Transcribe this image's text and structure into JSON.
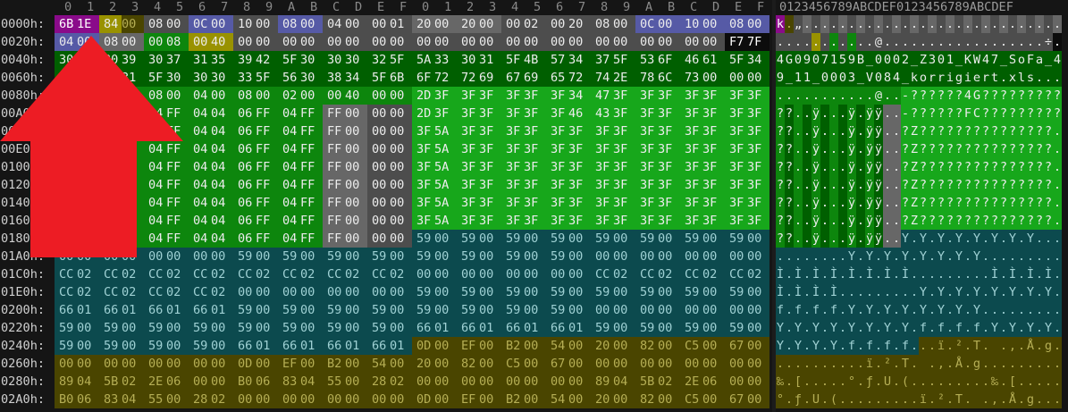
{
  "colors": {
    "green": "#0d860d",
    "lightgreen": "#17a71b",
    "darkgreen": "#005f00",
    "teal": "#0c4a4e",
    "olive": "#4a4500",
    "gray": "#4d4d4d",
    "lgray": "#676767",
    "purple": "#8a0b8a",
    "blue": "#565aa6",
    "yellow": "#999200",
    "white": "#ffffff",
    "black": "#0c0c0c",
    "arrow": "#ed1c24"
  },
  "header": {
    "hex_columns": "0 1 2 3 4 5 6 7 8 9 A B C D E F 0 1 2 3 4 5 6 7 8 9 A B C D E F",
    "ascii_columns": "0123456789ABCDEF0123456789ABCDEF"
  },
  "rows": [
    {
      "addr": "0000h:",
      "hex": "6B1E 8400 0800 0C00 1000 0800 0400 0001 2000 2000 0002 0020 0800 0C00 1000 0800",
      "ascii": "k.„.............................",
      "hex_bg": "rrrrr0rr88hhhhhhhh88rr88hh88hh88",
      "asc_bg": "rrh0hhhhhhhhhhhhhhhhhhhhhhhhhhhh",
      "hex_fg": "www.ww..ww..ww..ww..ww..ww......ww..ww....ww..wwww..ww..ww..ww..",
      "asc_fg": "wwwwwwwwwwwwwwwwwwwwwwwwwwwwwwww"
    },
    {
      "addr": "0020h:",
      "hex": "0400 0800 0008 0040 0000 0000 0000 0000 0000 0000 0000 0000 0000 0000 0000 F77F",
      "ascii": "...........@..................÷.",
      "hex_bg": "",
      "asc_bg": "",
      "hex_fg": "",
      "asc_fg": ""
    },
    {
      "addr": "0040h:",
      "hex": "3034 3039 3037 3135 3942 5F30 3030 325F 5A33 3031 5F4B 5734 375F 536F 4661 5F34",
      "ascii": "4G0907159B_0002_Z301_KW47_SoFa_4",
      "hex_bg": "",
      "asc_bg": "",
      "hex_fg": "",
      "asc_fg": ""
    },
    {
      "addr": "0060h:",
      "hex": "395F 3131 5F30 3030 335F 5630 3834 5F6B 6F72 7269 6769 6572 742E 786C 7300 0000",
      "ascii": "9_11_0003_V084_korrigiert.xls...",
      "hex_bg": "",
      "asc_bg": "",
      "hex_fg": "",
      "asc_fg": ""
    },
    {
      "addr": "0080h:",
      "hex": "0400 0000 0800 0400 0800 0200 0040 0000 2D3F 3F3F 3F3F 3F34 473F 3F3F 3F3F 3F3F",
      "ascii": "...........@..-??????4G?????????",
      "hex_bg": "",
      "asc_bg": "",
      "hex_fg": "",
      "asc_fg": ""
    },
    {
      "addr": "00A0h:",
      "hex": "04FF 04FF 04FF 0404 06FF 04FF FF00 0000 2D3F 3F3F 3F3F 3F46 433F 3F3F 3F3F 3F3F",
      "ascii": "??..ÿ...ÿ.ÿÿ..-??????FC?????????",
      "hex_bg": "",
      "asc_bg": "",
      "hex_fg": "",
      "asc_fg": ""
    },
    {
      "addr": "00C0h:",
      "hex": "04FF 04FF 04FF 0404 06FF 04FF FF00 0000 3F5A 3F3F 3F3F 3F3F 3F3F 3F3F 3F3F 3F3F",
      "ascii": "??..ÿ...ÿ.ÿÿ..?Z???????????????",
      "hex_bg": "",
      "asc_bg": "",
      "hex_fg": "",
      "asc_fg": ""
    },
    {
      "addr": "00E0h:",
      "hex": "04FF 04FF 04FF 0404 06FF 04FF FF00 0000 3F5A 3F3F 3F3F 3F3F 3F3F 3F3F 3F3F 3F3F",
      "ascii": "??..ÿ...ÿ.ÿÿ..?Z???????????????",
      "hex_bg": "",
      "asc_bg": "",
      "hex_fg": "",
      "asc_fg": ""
    },
    {
      "addr": "0100h:",
      "hex": "04FF 04FF 04FF 0404 06FF 04FF FF00 0000 3F5A 3F3F 3F3F 3F3F 3F3F 3F3F 3F3F 3F3F",
      "ascii": "??..ÿ...ÿ.ÿÿ..?Z???????????????",
      "hex_bg": "",
      "asc_bg": "",
      "hex_fg": "",
      "asc_fg": ""
    },
    {
      "addr": "0120h:",
      "hex": "04FF 04FF 04FF 0404 06FF 04FF FF00 0000 3F5A 3F3F 3F3F 3F3F 3F3F 3F3F 3F3F 3F3F",
      "ascii": "??..ÿ...ÿ.ÿÿ..?Z???????????????",
      "hex_bg": "",
      "asc_bg": "",
      "hex_fg": "",
      "asc_fg": ""
    },
    {
      "addr": "0140h:",
      "hex": "04FF 04FF 04FF 0404 06FF 04FF FF00 0000 3F5A 3F3F 3F3F 3F3F 3F3F 3F3F 3F3F 3F3F",
      "ascii": "??..ÿ...ÿ.ÿÿ..?Z???????????????",
      "hex_bg": "",
      "asc_bg": "",
      "hex_fg": "",
      "asc_fg": ""
    },
    {
      "addr": "0160h:",
      "hex": "04FF 04FF 04FF 0404 06FF 04FF FF00 0000 3F5A 3F3F 3F3F 3F3F 3F3F 3F3F 3F3F 3F3F",
      "ascii": "??..ÿ...ÿ.ÿÿ..?Z???????????????",
      "hex_bg": "",
      "asc_bg": "",
      "hex_fg": "",
      "asc_fg": ""
    },
    {
      "addr": "0180h:",
      "hex": "04FF 04FF 04FF 0404 06FF 04FF FF00 0000 5900 5900 5900 5900 5900 5900 5900 5900",
      "ascii": "??..ÿ...ÿ.ÿÿ..Y.Y.Y.Y.Y.Y.Y.Y.",
      "hex_bg": "",
      "asc_bg": "",
      "hex_fg": "",
      "asc_fg": ""
    },
    {
      "addr": "01A0h:",
      "hex": "0000 0000 0000 0000 5900 5900 5900 5900 5900 5900 5900 5900 0000 0000 0000 0000",
      "ascii": "........Y.Y.Y.Y.Y.Y.Y.Y.........",
      "hex_bg": "",
      "asc_bg": "",
      "hex_fg": "",
      "asc_fg": ""
    },
    {
      "addr": "01C0h:",
      "hex": "CC02 CC02 CC02 CC02 CC02 CC02 CC02 CC02 0000 0000 0000 0000 CC02 CC02 CC02 CC02",
      "ascii": "Ì.Ì.Ì.Ì.Ì.Ì.Ì.Ì.........Ì.Ì.Ì.Ì.",
      "hex_bg": "",
      "asc_bg": "",
      "hex_fg": "",
      "asc_fg": ""
    },
    {
      "addr": "01E0h:",
      "hex": "CC02 CC02 CC02 CC02 0000 0000 0000 0000 5900 5900 5900 5900 5900 5900 5900 5900",
      "ascii": "Ì.Ì.Ì.Ì.........Y.Y.Y.Y.Y.Y.Y.Y.",
      "hex_bg": "",
      "asc_bg": "",
      "hex_fg": "",
      "asc_fg": ""
    },
    {
      "addr": "0200h:",
      "hex": "6601 6601 6601 6601 5900 5900 5900 5900 5900 5900 5900 5900 0000 0000 0000 0000",
      "ascii": "f.f.f.f.Y.Y.Y.Y.Y.Y.Y.Y.........",
      "hex_bg": "",
      "asc_bg": "",
      "hex_fg": "",
      "asc_fg": ""
    },
    {
      "addr": "0220h:",
      "hex": "5900 5900 5900 5900 5900 5900 5900 5900 6601 6601 6601 6601 5900 5900 5900 5900",
      "ascii": "Y.Y.Y.Y.Y.Y.Y.Y.f.f.f.f.Y.Y.Y.Y.",
      "hex_bg": "",
      "asc_bg": "",
      "hex_fg": "",
      "asc_fg": ""
    },
    {
      "addr": "0240h:",
      "hex": "5900 5900 5900 5900 6601 6601 6601 6601 0D00 EF00 B200 5400 2000 8200 C500 6700",
      "ascii": "Y.Y.Y.Y.f.f.f.f...ï.².T. .‚.Å.g.",
      "hex_bg": "",
      "asc_bg": "",
      "hex_fg": "",
      "asc_fg": ""
    },
    {
      "addr": "0260h:",
      "hex": "0000 0000 0000 0000 0D00 EF00 B200 5400 2000 8200 C500 6700 0000 0000 0000 0000",
      "ascii": "..........ï.².T. .‚.Å.g.........",
      "hex_bg": "",
      "asc_bg": "",
      "hex_fg": "",
      "asc_fg": ""
    },
    {
      "addr": "0280h:",
      "hex": "8904 5B02 2E06 0000 B006 8304 5500 2802 0000 0000 0000 0000 8904 5B02 2E06 0000",
      "ascii": "‰.[.....°.ƒ.U.(.........‰.[.....",
      "hex_bg": "",
      "asc_bg": "",
      "hex_fg": "",
      "asc_fg": ""
    },
    {
      "addr": "02A0h:",
      "hex": "B006 8304 5500 2802 0000 0000 0000 0000 0D00 EF00 B200 5400 2000 8200 C500 6700",
      "ascii": "°.ƒ.U.(.........ï.².T. .‚.Å.g.",
      "hex_bg": "",
      "asc_bg": "",
      "hex_fg": "",
      "asc_fg": ""
    }
  ]
}
